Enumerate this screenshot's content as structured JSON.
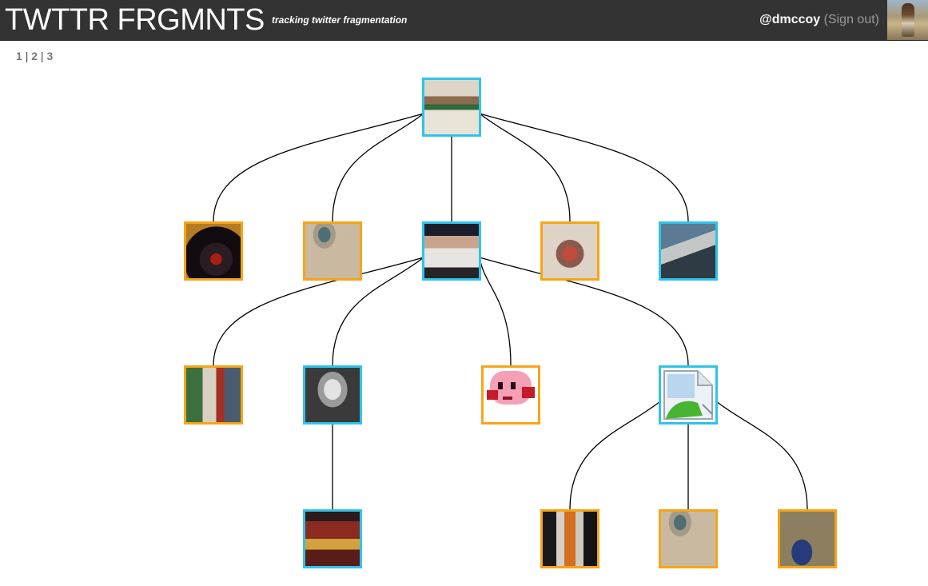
{
  "header": {
    "title": "TWTTR FRGMNTS",
    "tagline": "tracking twitter fragmentation",
    "username": "@dmccoy",
    "signout_label": "(Sign out)"
  },
  "pager": {
    "pages": [
      "1",
      "2",
      "3"
    ],
    "separator": "|"
  },
  "colors": {
    "header_bg": "#333333",
    "border_blue": "#2fc3ea",
    "border_orange": "#f6a516",
    "edge": "#000000"
  },
  "tree": {
    "nodes": [
      {
        "id": "n0",
        "border": "blue",
        "picture": "man-with-lei"
      },
      {
        "id": "n1",
        "border": "orange",
        "picture": "dark-red-emblem"
      },
      {
        "id": "n2",
        "border": "orange",
        "picture": "eye-closeup"
      },
      {
        "id": "n3",
        "border": "blue",
        "picture": "man-in-cap"
      },
      {
        "id": "n4",
        "border": "orange",
        "picture": "bomb-illustration"
      },
      {
        "id": "n5",
        "border": "blue",
        "picture": "man-in-car"
      },
      {
        "id": "n6",
        "border": "orange",
        "picture": "man-with-posters"
      },
      {
        "id": "n7",
        "border": "blue",
        "picture": "bald-man-bw"
      },
      {
        "id": "n8",
        "border": "orange",
        "picture": "kirby-sprite"
      },
      {
        "id": "n9",
        "border": "blue",
        "picture": "broken-image-icon"
      },
      {
        "id": "n10",
        "border": "blue",
        "picture": "album-cover"
      },
      {
        "id": "n11",
        "border": "orange",
        "picture": "robot-figure"
      },
      {
        "id": "n12",
        "border": "orange",
        "picture": "eye-closeup"
      },
      {
        "id": "n13",
        "border": "orange",
        "picture": "feet-on-carpet"
      }
    ],
    "edges": [
      [
        "n0",
        "n1"
      ],
      [
        "n0",
        "n2"
      ],
      [
        "n0",
        "n3"
      ],
      [
        "n0",
        "n4"
      ],
      [
        "n0",
        "n5"
      ],
      [
        "n3",
        "n6"
      ],
      [
        "n3",
        "n7"
      ],
      [
        "n3",
        "n8"
      ],
      [
        "n3",
        "n9"
      ],
      [
        "n7",
        "n10"
      ],
      [
        "n9",
        "n11"
      ],
      [
        "n9",
        "n12"
      ],
      [
        "n9",
        "n13"
      ]
    ]
  }
}
